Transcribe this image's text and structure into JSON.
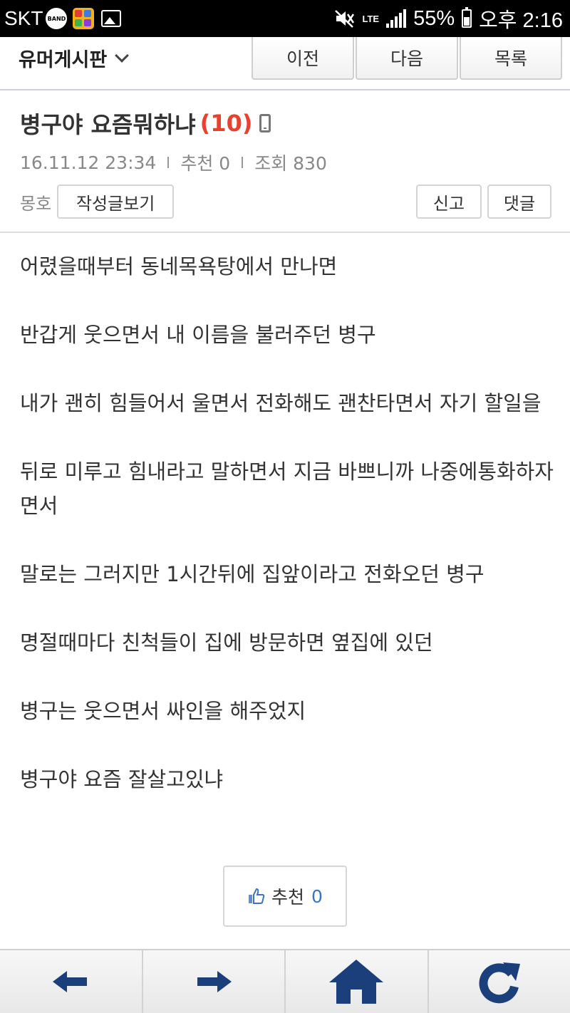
{
  "statusbar": {
    "carrier": "SKT",
    "band_label": "BAND",
    "network": "LTE",
    "battery": "55%",
    "time": "오후 2:16"
  },
  "header": {
    "board_name": "유머게시판",
    "prev_label": "이전",
    "next_label": "다음",
    "list_label": "목록"
  },
  "post": {
    "title": "병구야 요즘뭐하냐",
    "comment_count": "(10)",
    "date": "16.11.12  23:34",
    "recommend_meta": "추천 0",
    "views_meta": "조회 830",
    "author": "몽호",
    "view_posts_label": "작성글보기",
    "report_label": "신고",
    "comment_label": "댓글",
    "paragraphs": [
      "어렸을때부터 동네목욕탕에서 만나면",
      "반갑게 웃으면서 내 이름을 불러주던 병구",
      "내가 괜히 힘들어서 울면서 전화해도 괜찬타면서 자기 할일을",
      "뒤로 미루고 힘내라고 말하면서 지금 바쁘니까 나중에통화하자면서",
      "말로는 그러지만 1시간뒤에 집앞이라고 전화오던 병구",
      "명절때마다 친척들이 집에 방문하면 옆집에 있던",
      "병구는 웃으면서 싸인을 해주었지",
      "병구야 요즘 잘살고있냐"
    ],
    "recommend_label": "추천",
    "recommend_count": "0"
  },
  "bottombar": {
    "icons": [
      "back-arrow-icon",
      "forward-arrow-icon",
      "home-icon",
      "refresh-icon"
    ],
    "icon_color": "#1b3f7a"
  },
  "colors": {
    "accent_red": "#e8412d",
    "link_blue": "#3c74c4"
  }
}
